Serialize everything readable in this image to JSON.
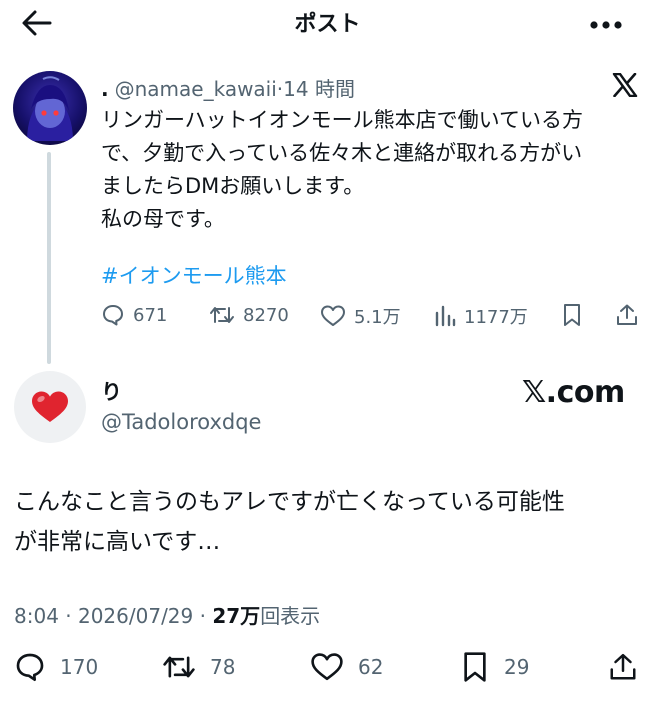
{
  "header": {
    "title": "ポスト"
  },
  "parent_post": {
    "display_name": ".",
    "handle": "@namae_kawaii",
    "separator": "·",
    "time": "14 時間",
    "lines": [
      "リンガーハットイオンモール熊本店で働いている方",
      "で、夕勤で入っている佐々木と連絡が取れる方がい",
      "ましたらDMお願いします。",
      "私の母です。"
    ],
    "hashtag": "#イオンモール熊本",
    "stats": {
      "replies": "671",
      "reposts": "8270",
      "likes": "5.1万",
      "views": "1177万"
    }
  },
  "reply": {
    "display_name": "り",
    "handle": "@Tadoloroxdqe",
    "brand": "𝕏.com",
    "lines": [
      "こんなこと言うのもアレですが亡くなっている可能性",
      "が非常に高いです…"
    ],
    "timestamp": "8:04 · 2026/07/29 · ",
    "view_count": "27万",
    "view_label": "回表示",
    "stats": {
      "replies": "170",
      "reposts": "78",
      "likes": "62",
      "bookmarks": "29"
    }
  },
  "icons": {
    "back": "arrow-left-icon",
    "more": "more-horizontal-icon",
    "x_logo": "x-logo-icon",
    "reply": "speech-bubble-icon",
    "repost": "repost-icon",
    "like": "heart-icon",
    "views": "bar-chart-icon",
    "bookmark": "bookmark-icon",
    "share": "share-icon",
    "avatar2": "red-heart-icon"
  },
  "colors": {
    "text": "#0f1419",
    "muted": "#536471",
    "link": "#1d9bf0",
    "thread_line": "#cfd9de",
    "heart": "#e0242f"
  }
}
